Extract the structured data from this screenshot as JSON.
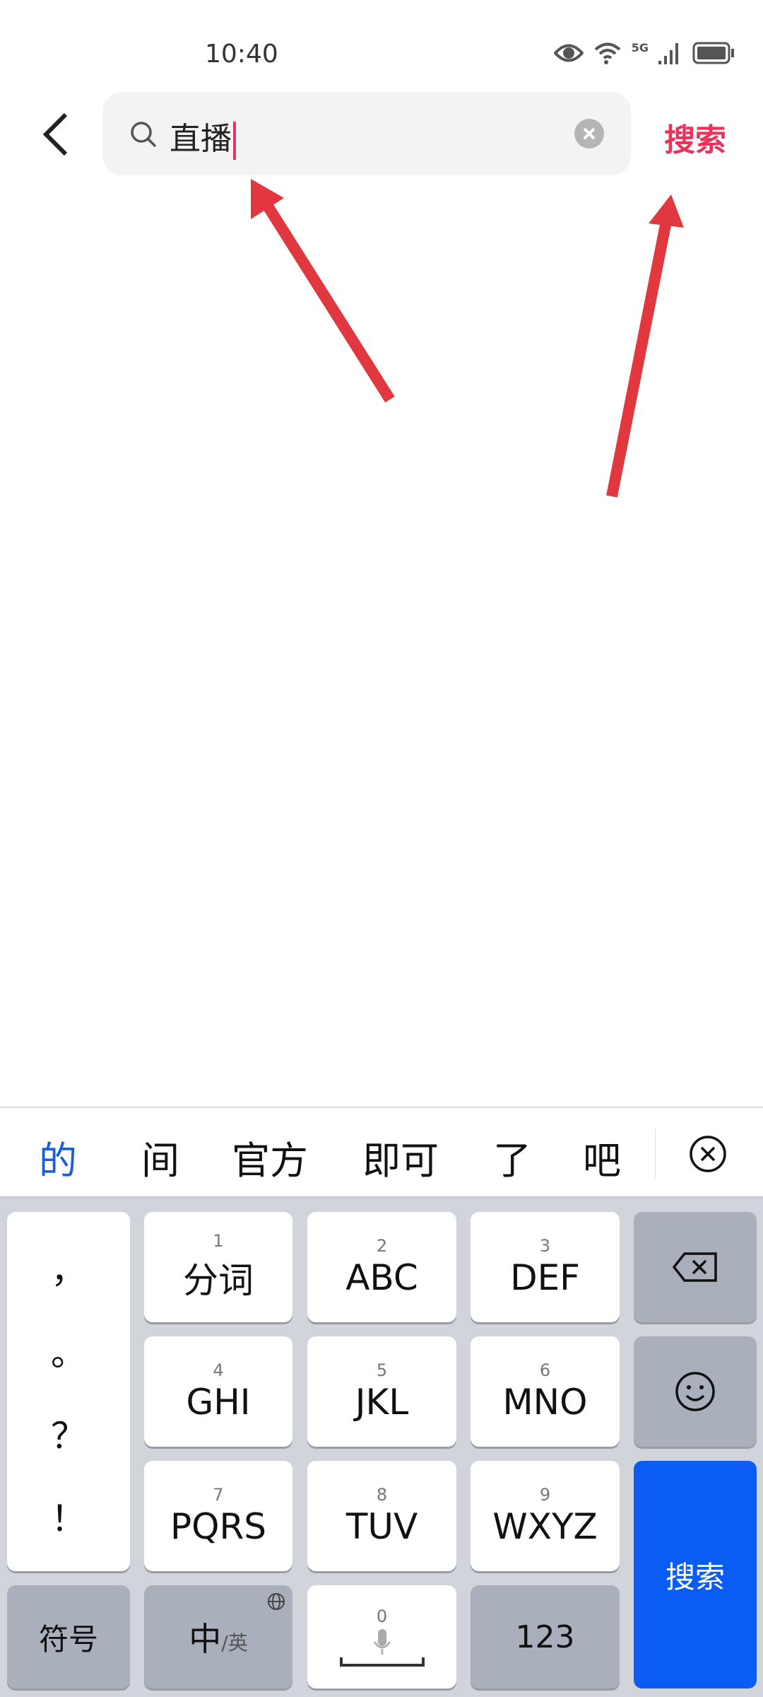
{
  "status": {
    "time": "10:40",
    "network": "5G",
    "icons": [
      "eye-icon",
      "wifi-icon",
      "signal-icon",
      "battery-icon"
    ]
  },
  "search": {
    "value": "直播",
    "button": "搜索"
  },
  "annotations": {
    "color": "#e0383e",
    "count": 2
  },
  "candidates": {
    "items": [
      "的",
      "间",
      "官方",
      "即可",
      "了",
      "吧"
    ],
    "highlight_color": "#1a5fd6"
  },
  "keyboard": {
    "punct": [
      "，",
      "。",
      "？",
      "！"
    ],
    "keys": [
      {
        "num": "1",
        "label": "分词"
      },
      {
        "num": "2",
        "label": "ABC"
      },
      {
        "num": "3",
        "label": "DEF"
      },
      {
        "num": "4",
        "label": "GHI"
      },
      {
        "num": "5",
        "label": "JKL"
      },
      {
        "num": "6",
        "label": "MNO"
      },
      {
        "num": "7",
        "label": "PQRS"
      },
      {
        "num": "8",
        "label": "TUV"
      },
      {
        "num": "9",
        "label": "WXYZ"
      }
    ],
    "symbols": "符号",
    "lang_main": "中",
    "lang_alt": "/英",
    "space_num": "0",
    "num_mode": "123",
    "enter": "搜索",
    "enter_color": "#0a5cf5"
  }
}
